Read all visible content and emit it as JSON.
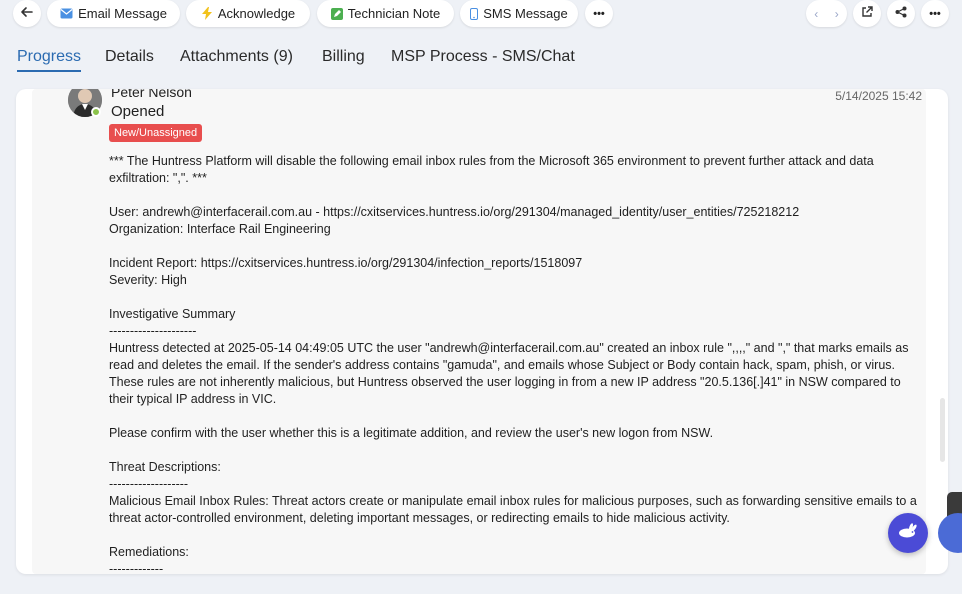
{
  "toolbar": {
    "back_icon": "arrow-left-icon",
    "email_label": "Email Message",
    "acknowledge_label": "Acknowledge",
    "technician_note_label": "Technician Note",
    "sms_label": "SMS Message",
    "more_label": "•••",
    "prev_symbol": "‹",
    "next_symbol": "›",
    "more_right_label": "•••"
  },
  "tabs": [
    {
      "label": "Progress",
      "active": true
    },
    {
      "label": "Details"
    },
    {
      "label": "Attachments (9)"
    },
    {
      "label": "Billing"
    },
    {
      "label": "MSP Process - SMS/Chat"
    }
  ],
  "entry": {
    "author": "Peter Nelson",
    "status": "Opened",
    "badge": "New/Unassigned",
    "timestamp": "5/14/2025 15:42",
    "paragraphs": [
      "*** The Huntress Platform will disable the following email inbox rules from the Microsoft 365 environment to prevent further attack and data exfiltration: \",\". ***",
      "User: andrewh@interfacerail.com.au - https://cxitservices.huntress.io/org/291304/managed_identity/user_entities/725218212\nOrganization: Interface Rail Engineering",
      "Incident Report: https://cxitservices.huntress.io/org/291304/infection_reports/1518097\nSeverity: High",
      "Investigative Summary\n---------------------\nHuntress detected at 2025-05-14 04:49:05 UTC the user \"andrewh@interfacerail.com.au\" created an inbox rule \",,,,\" and \",\" that marks emails as read and deletes the email. If the sender's address contains \"gamuda\", and emails whose Subject or Body contain hack, spam, phish, or virus. These rules are not inherently malicious, but Huntress observed the user logging in from a new IP address \"20.5.136[.]41\" in NSW compared to their typical IP address in VIC.",
      "Please confirm with the user whether this is a legitimate addition, and review the user's new logon from NSW.",
      "Threat Descriptions:\n-------------------\nMalicious Email Inbox Rules: Threat actors create or manipulate email inbox rules for malicious purposes, such as forwarding sensitive emails to a threat actor-controlled environment, deleting important messages, or redirecting emails to hide malicious activity.",
      "Remediations:\n-------------"
    ]
  },
  "colors": {
    "accent": "#2b6bb1",
    "badge": "#e84e4e",
    "online": "#8bc34a",
    "fab": "#4b4bd6"
  }
}
